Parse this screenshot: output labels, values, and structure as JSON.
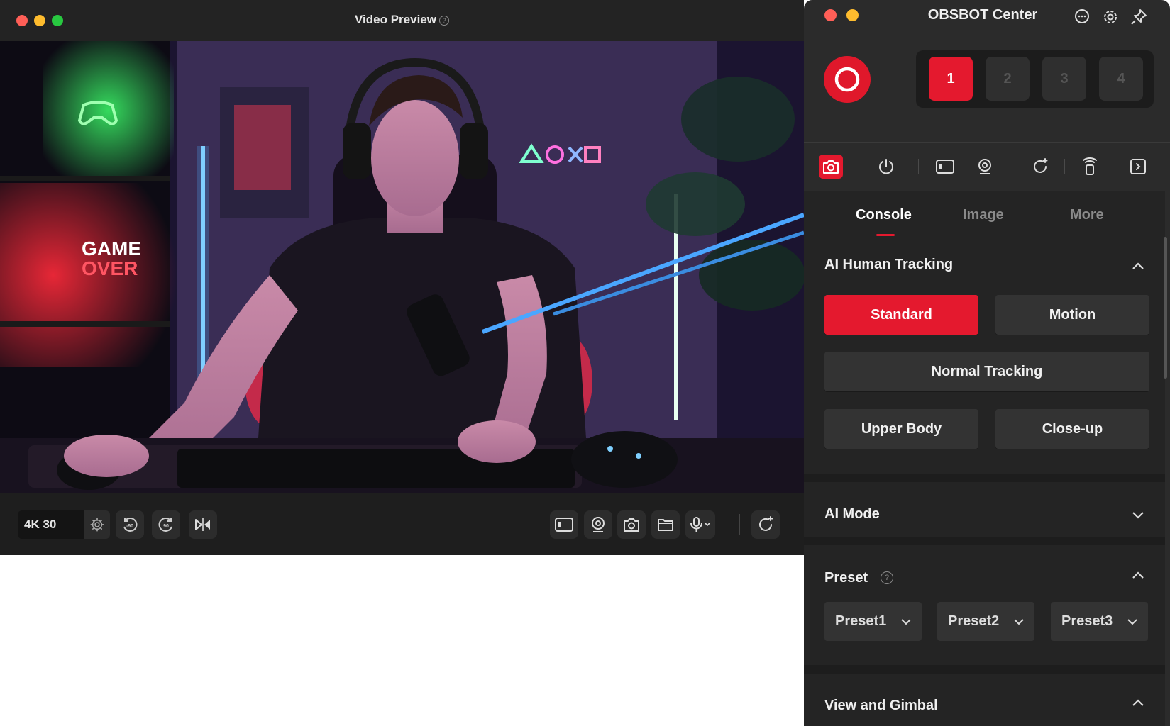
{
  "preview": {
    "title": "Video Preview",
    "help": "?",
    "neon_sign": "GAME OVER",
    "neon_line1": "GAME",
    "neon_line2": "OVER",
    "resolution": "4K 30",
    "rotate_left_label": "-90",
    "rotate_right_label": "90",
    "colors": {
      "window_bg": "#1f1f1f",
      "traffic_red": "#ff5f57",
      "traffic_yellow": "#febc2e",
      "traffic_green": "#28c840"
    }
  },
  "panel": {
    "title": "OBSBOT Center",
    "camera_slots": [
      "1",
      "2",
      "3",
      "4"
    ],
    "active_slot": "1",
    "tabs": [
      "Console",
      "Image",
      "More"
    ],
    "active_tab": "Console",
    "ai_tracking": {
      "title": "AI Human Tracking",
      "mode_buttons": [
        "Standard",
        "Motion"
      ],
      "active_mode": "Standard",
      "tracking_button": "Normal Tracking",
      "framing_buttons": [
        "Upper Body",
        "Close-up"
      ]
    },
    "ai_mode": {
      "title": "AI Mode"
    },
    "preset": {
      "title": "Preset",
      "help": "?",
      "items": [
        "Preset1",
        "Preset2",
        "Preset3"
      ]
    },
    "view_gimbal": {
      "title": "View and Gimbal"
    },
    "colors": {
      "accent": "#e4192e",
      "panel_bg": "#2b2b2b",
      "content_bg": "#242424"
    }
  }
}
